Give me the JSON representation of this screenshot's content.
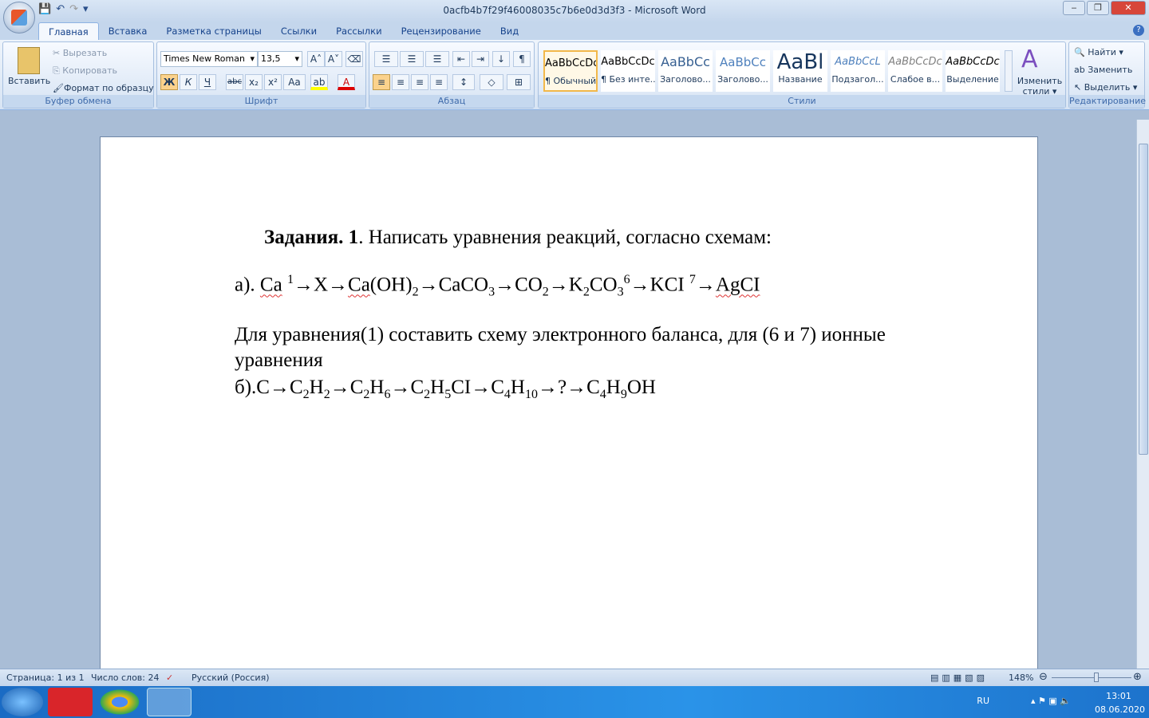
{
  "window": {
    "title": "0acfb4b7f29f46008035c7b6e0d3d3f3 - Microsoft Word",
    "min": "‒",
    "max": "❐",
    "close": "✕"
  },
  "qat": {
    "save": "💾",
    "undo": "↶",
    "redo": "↷",
    "more": "▾"
  },
  "tabs": [
    "Главная",
    "Вставка",
    "Разметка страницы",
    "Ссылки",
    "Рассылки",
    "Рецензирование",
    "Вид"
  ],
  "help": "?",
  "clipboard": {
    "paste": "Вставить",
    "cut": "Вырезать",
    "copy": "Копировать",
    "format": "Формат по образцу",
    "label": "Буфер обмена"
  },
  "font": {
    "name": "Times New Roman",
    "size": "13,5",
    "label": "Шрифт",
    "bold": "Ж",
    "italic": "К",
    "underline": "Ч",
    "strike": "abc",
    "sub": "x₂",
    "sup": "x²",
    "case": "Aa",
    "grow": "A˄",
    "shrink": "A˅",
    "highlight": "ab",
    "color": "A"
  },
  "paragraph": {
    "label": "Абзац"
  },
  "styles": {
    "label": "Стили",
    "items": [
      {
        "sample": "AaBbCcDc",
        "name": "¶ Обычный"
      },
      {
        "sample": "AaBbCcDc",
        "name": "¶ Без инте..."
      },
      {
        "sample": "AaBbCc",
        "name": "Заголово..."
      },
      {
        "sample": "AaBbCc",
        "name": "Заголово..."
      },
      {
        "sample": "AaBl",
        "name": "Название"
      },
      {
        "sample": "AaBbCcL",
        "name": "Подзагол..."
      },
      {
        "sample": "AaBbCcDc",
        "name": "Слабое в..."
      },
      {
        "sample": "AaBbCcDc",
        "name": "Выделение"
      }
    ],
    "change": "Изменить стили ▾"
  },
  "editing": {
    "label": "Редактирование",
    "find": "Найти ▾",
    "replace": "Заменить",
    "select": "Выделить ▾"
  },
  "doc": {
    "title_bold": "Задания. 1",
    "title_rest": ". Написать уравнения реакций, согласно схемам:",
    "eq_a": [
      [
        "t",
        "а). "
      ],
      [
        "sq",
        "Ca"
      ],
      [
        "t",
        " "
      ],
      [
        "sup",
        "1"
      ],
      [
        "t",
        "→X→"
      ],
      [
        "sq",
        "Ca"
      ],
      [
        "t",
        "(OH)"
      ],
      [
        "sub",
        "2"
      ],
      [
        "t",
        "→CaCO"
      ],
      [
        "sub",
        "3"
      ],
      [
        "t",
        "→CO"
      ],
      [
        "sub",
        "2"
      ],
      [
        "t",
        "→K"
      ],
      [
        "sub",
        "2"
      ],
      [
        "t",
        "CO"
      ],
      [
        "sub",
        "3"
      ],
      [
        "sup",
        "6"
      ],
      [
        "t",
        "→KCI "
      ],
      [
        "sup",
        "7"
      ],
      [
        "t",
        "→"
      ],
      [
        "sq",
        "AgCI"
      ]
    ],
    "para1": "Для уравнения(1) составить схему электронного баланса, для (6 и 7) ионные",
    "para2": "уравнения",
    "eq_b": [
      [
        "t",
        "б).C→C"
      ],
      [
        "sub",
        "2"
      ],
      [
        "t",
        "H"
      ],
      [
        "sub",
        "2"
      ],
      [
        "t",
        "→C"
      ],
      [
        "sub",
        "2"
      ],
      [
        "t",
        "H"
      ],
      [
        "sub",
        "6"
      ],
      [
        "t",
        "→C"
      ],
      [
        "sub",
        "2"
      ],
      [
        "t",
        "H"
      ],
      [
        "sub",
        "5"
      ],
      [
        "t",
        "CI→C"
      ],
      [
        "sub",
        "4"
      ],
      [
        "t",
        "H"
      ],
      [
        "sub",
        "10"
      ],
      [
        "t",
        "→?→C"
      ],
      [
        "sub",
        "4"
      ],
      [
        "t",
        "H"
      ],
      [
        "sub",
        "9"
      ],
      [
        "t",
        "OH"
      ]
    ]
  },
  "status": {
    "page": "Страница: 1 из 1",
    "words": "Число слов: 24",
    "lang": "Русский (Россия)",
    "zoom": "148%",
    "zoom_level": 148
  },
  "tray": {
    "lang": "RU",
    "time": "13:01",
    "date": "08.06.2020"
  }
}
